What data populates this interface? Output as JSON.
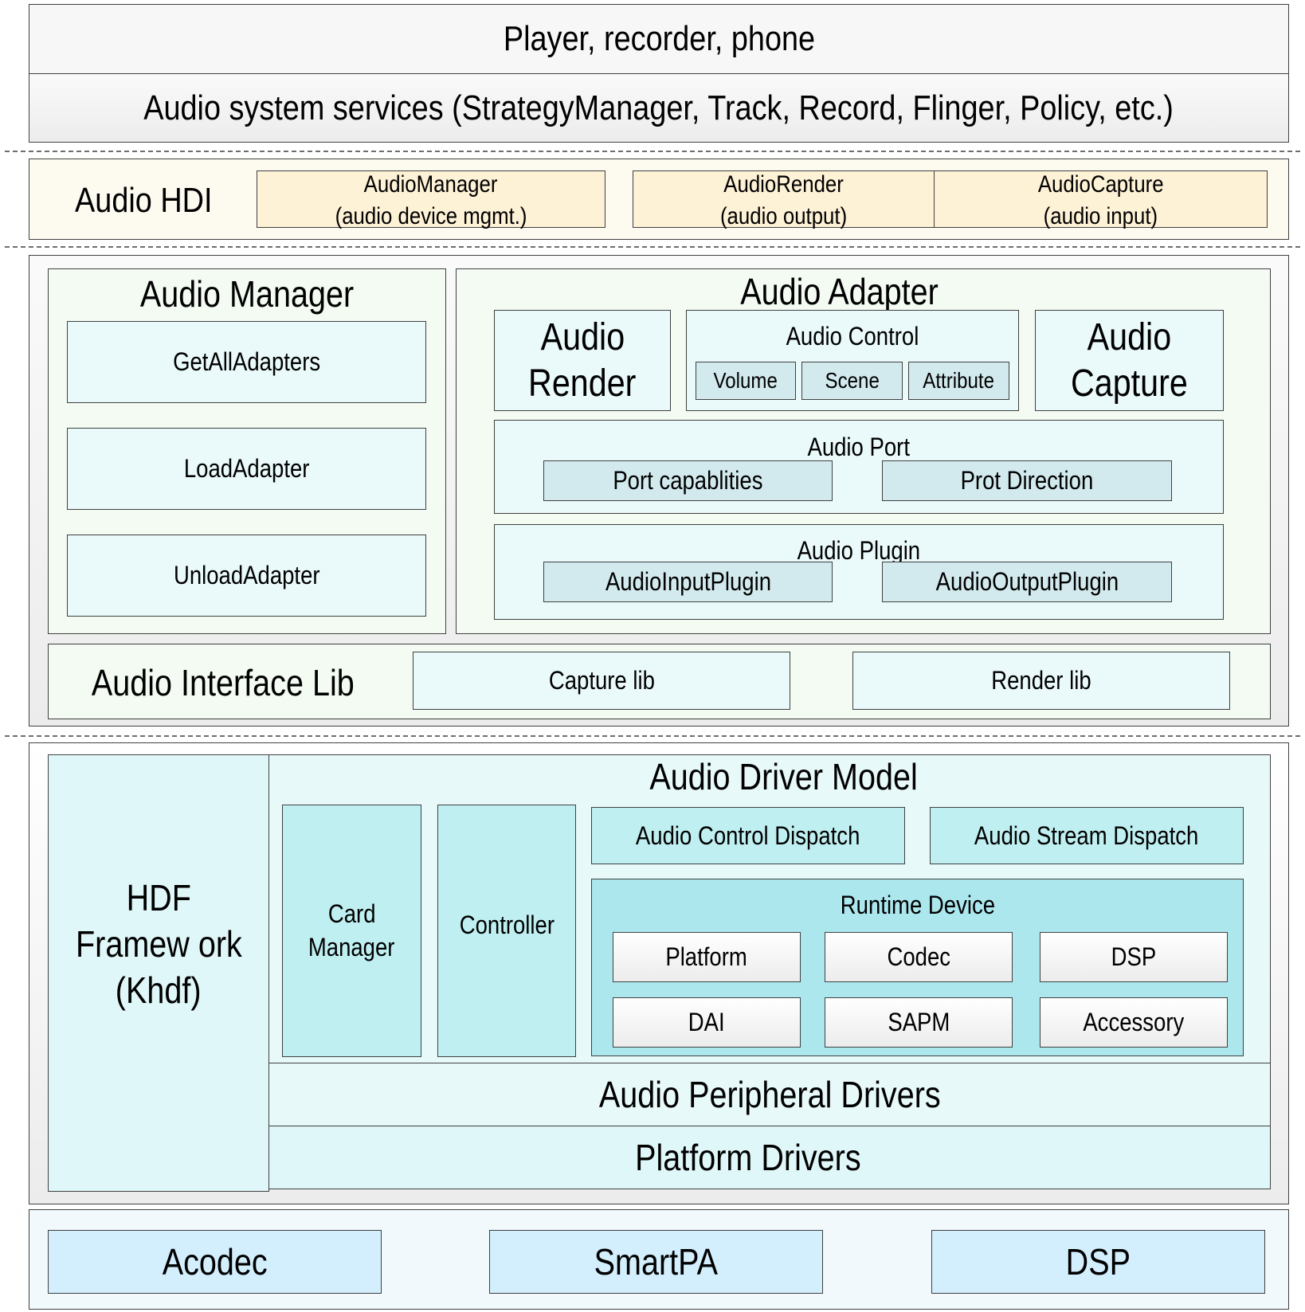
{
  "app_layer": {
    "apps_label": "Player, recorder, phone",
    "services_label": "Audio system services (StrategyManager, Track, Record, Flinger, Policy, etc.)"
  },
  "hdi_layer": {
    "title": "Audio HDI",
    "interfaces": [
      {
        "name": "AudioManager",
        "desc": "(audio device mgmt.)"
      },
      {
        "name": "AudioRender",
        "desc": "(audio output)"
      },
      {
        "name": "AudioCapture",
        "desc": "(audio input)"
      }
    ]
  },
  "hal_layer": {
    "audio_manager": {
      "title": "Audio Manager",
      "functions": [
        "GetAllAdapters",
        "LoadAdapter",
        "UnloadAdapter"
      ]
    },
    "audio_adapter": {
      "title": "Audio Adapter",
      "render_line1": "Audio",
      "render_line2": "Render",
      "capture_line1": "Audio",
      "capture_line2": "Capture",
      "control": {
        "title": "Audio Control",
        "items": [
          "Volume",
          "Scene",
          "Attribute"
        ]
      },
      "port": {
        "title": "Audio Port",
        "items": [
          "Port capablities",
          "Prot Direction"
        ]
      },
      "plugin": {
        "title": "Audio Plugin",
        "items": [
          "AudioInputPlugin",
          "AudioOutputPlugin"
        ]
      }
    },
    "interface_lib": {
      "title": "Audio Interface Lib",
      "items": [
        "Capture lib",
        "Render lib"
      ]
    }
  },
  "kernel_layer": {
    "hdf_line1": "HDF",
    "hdf_line2": "Framew ork",
    "hdf_line3": "(Khdf)",
    "driver_model": {
      "title": "Audio Driver Model",
      "card_manager_line1": "Card",
      "card_manager_line2": "Manager",
      "controller": "Controller",
      "control_dispatch": "Audio Control Dispatch",
      "stream_dispatch": "Audio Stream Dispatch",
      "runtime_device": {
        "title": "Runtime Device",
        "items": [
          "Platform",
          "Codec",
          "DSP",
          "DAI",
          "SAPM",
          "Accessory"
        ]
      }
    },
    "peripheral_drivers": "Audio Peripheral Drivers",
    "platform_drivers": "Platform Drivers"
  },
  "hardware_layer": {
    "items": [
      "Acodec",
      "SmartPA",
      "DSP"
    ]
  },
  "colors": {
    "border": "#404040",
    "app_gray": "#f2f2f2",
    "hdi_bg": "#fdfaf0",
    "hdi_box": "#fdf1d6",
    "hal_outer": "#f2f2f2",
    "hal_panel": "#f3fbf3",
    "hal_box": "#eaf9f9",
    "hal_inner": "#d2eaee",
    "kernel_panel": "#e0f7f9",
    "kernel_box": "#bfeff1",
    "runtime_bg": "#ace7ee",
    "hw_bg": "#f1f9fd",
    "hw_box": "#d3effd"
  }
}
